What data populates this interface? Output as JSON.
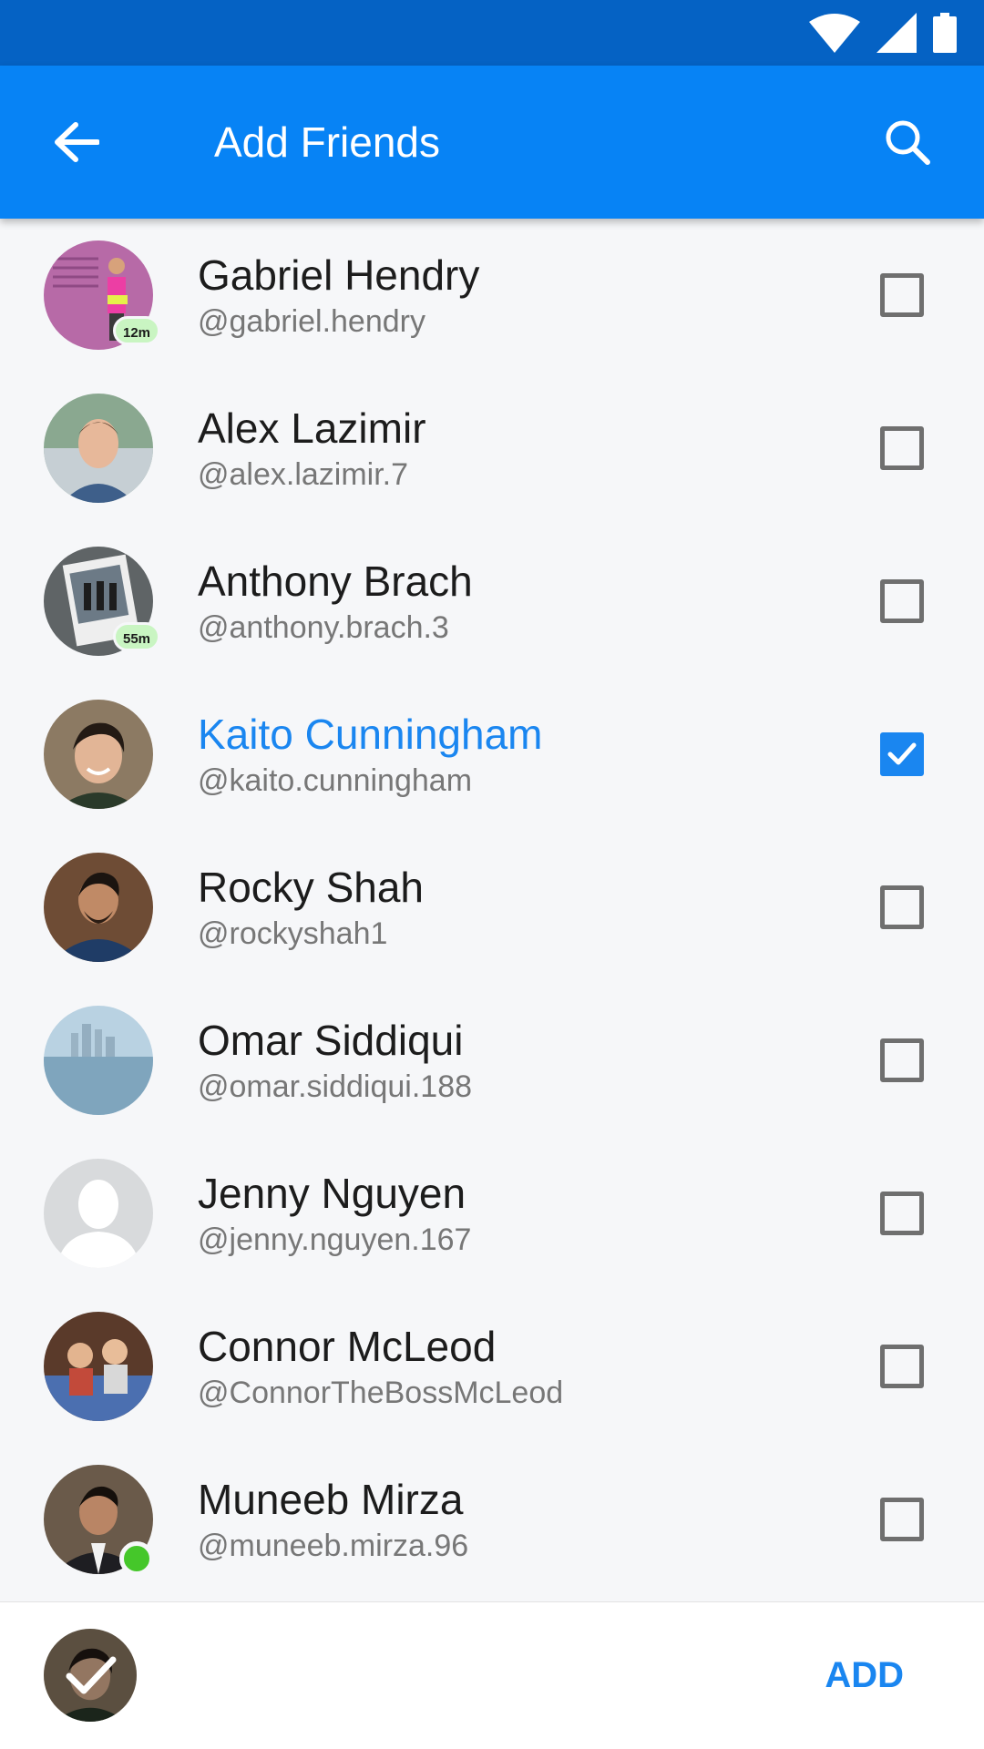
{
  "app_bar": {
    "title": "Add Friends",
    "back_icon": "arrow-left-icon",
    "search_icon": "search-icon",
    "color": "#0783f5",
    "status_bar_color": "#0562c4"
  },
  "status_bar": {
    "icons": [
      "wifi-icon",
      "cell-signal-icon",
      "battery-icon"
    ]
  },
  "accent_color": "#1a86f0",
  "friends": [
    {
      "name": "Gabriel Hendry",
      "handle": "@gabriel.hendry",
      "badge": "12m",
      "checked": false
    },
    {
      "name": "Alex Lazimir",
      "handle": "@alex.lazimir.7",
      "checked": false
    },
    {
      "name": "Anthony Brach",
      "handle": "@anthony.brach.3",
      "badge": "55m",
      "checked": false
    },
    {
      "name": "Kaito Cunningham",
      "handle": "@kaito.cunningham",
      "checked": true
    },
    {
      "name": "Rocky Shah",
      "handle": "@rockyshah1",
      "checked": false
    },
    {
      "name": "Omar Siddiqui",
      "handle": "@omar.siddiqui.188",
      "checked": false
    },
    {
      "name": "Jenny Nguyen",
      "handle": "@jenny.nguyen.167",
      "checked": false
    },
    {
      "name": "Connor McLeod",
      "handle": "@ConnorTheBossMcLeod",
      "checked": false
    },
    {
      "name": "Muneeb Mirza",
      "handle": "@muneeb.mirza.96",
      "online": true,
      "checked": false
    }
  ],
  "bottom_bar": {
    "add_label": "ADD",
    "selected_icon": "checkmark-icon"
  }
}
